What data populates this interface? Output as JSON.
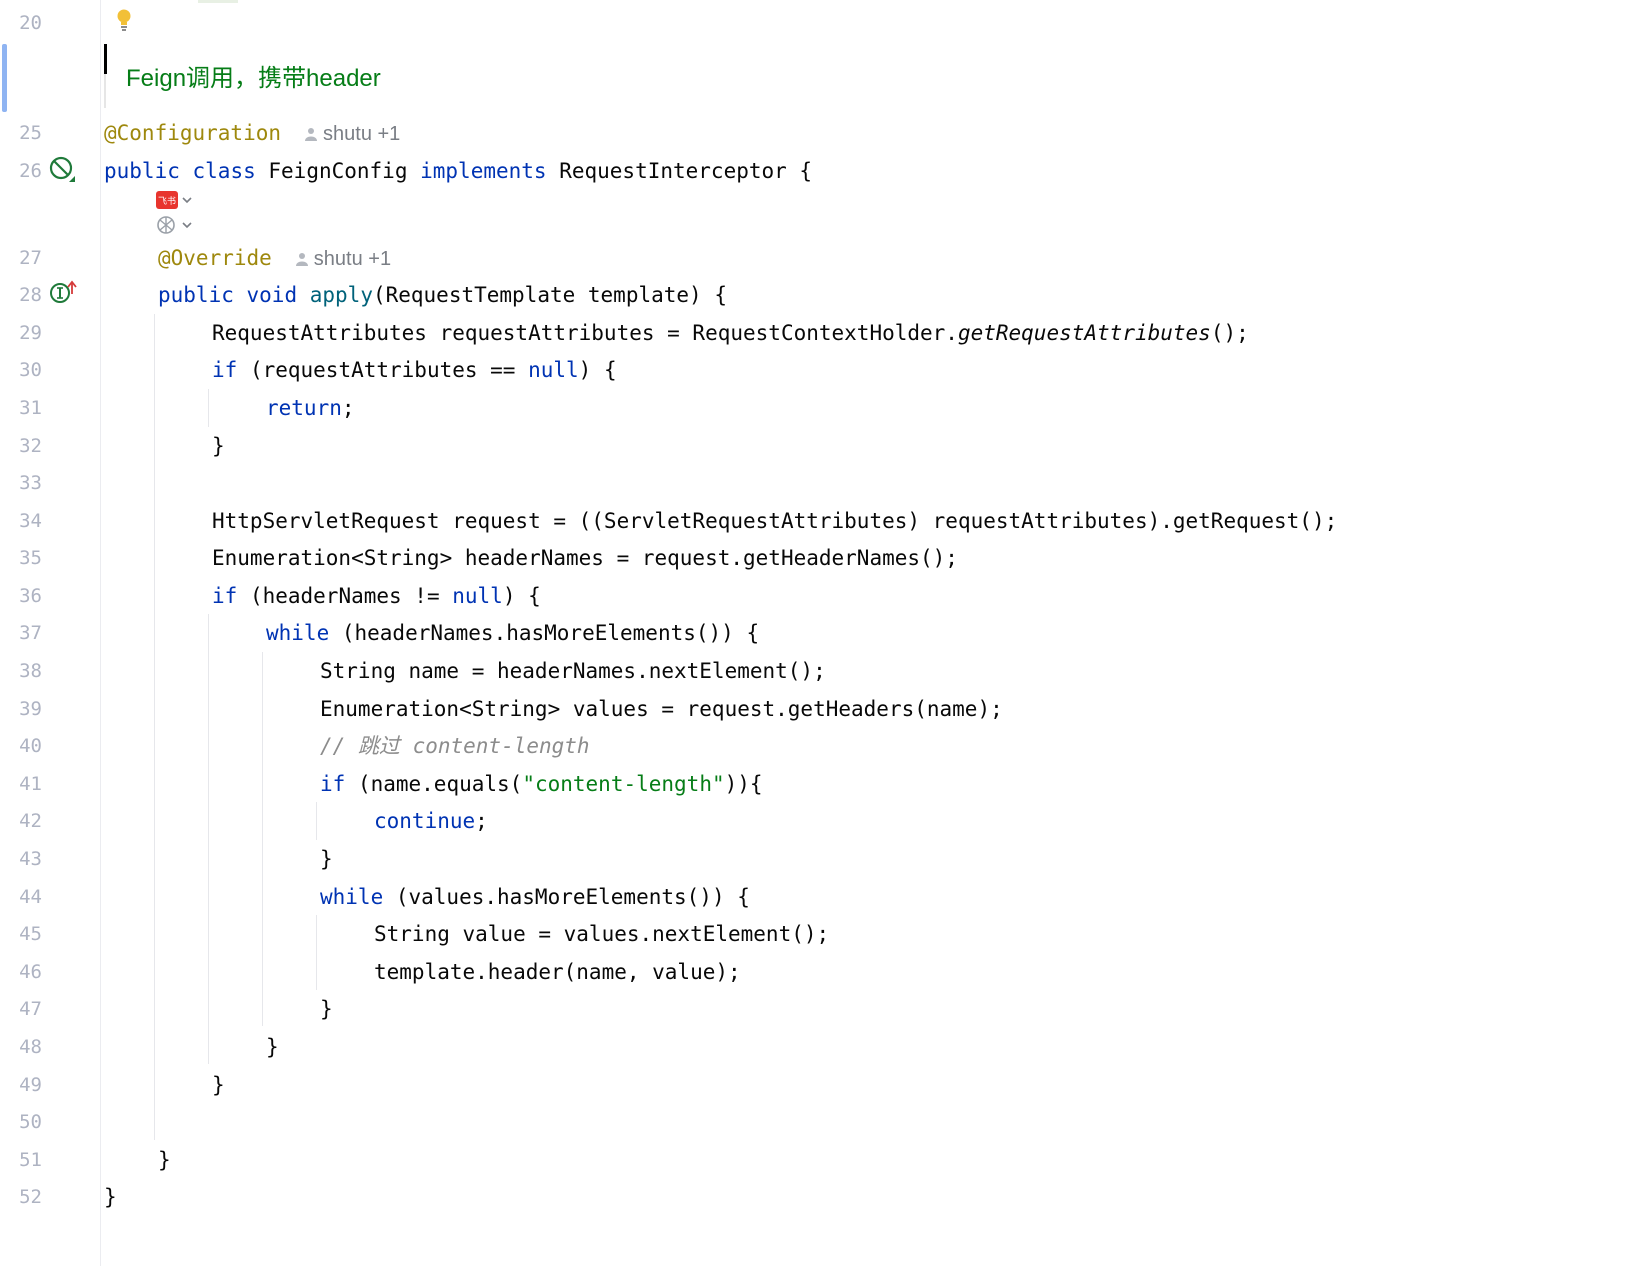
{
  "doc_comment": "Feign调用，携带header",
  "author_hint": "shutu +1",
  "line_numbers": [
    "20",
    "25",
    "26",
    "27",
    "28",
    "29",
    "30",
    "31",
    "32",
    "33",
    "34",
    "35",
    "36",
    "37",
    "38",
    "39",
    "40",
    "41",
    "42",
    "43",
    "44",
    "45",
    "46",
    "47",
    "48",
    "49",
    "50",
    "51",
    "52"
  ],
  "code": {
    "l25": "@Configuration",
    "l26_public": "public",
    "l26_class": "class",
    "l26_name": "FeignConfig",
    "l26_implements": "implements",
    "l26_iface": "RequestInterceptor {",
    "l27": "@Override",
    "l28_public": "public",
    "l28_void": "void",
    "l28_apply": "apply",
    "l28_rest": "(RequestTemplate template) {",
    "l29_a": "RequestAttributes requestAttributes = RequestContextHolder.",
    "l29_b": "getRequestAttributes",
    "l29_c": "();",
    "l30_if": "if",
    "l30_a": " (requestAttributes == ",
    "l30_null": "null",
    "l30_b": ") {",
    "l31": "return",
    "l31_semi": ";",
    "l32": "}",
    "l34": "HttpServletRequest request = ((ServletRequestAttributes) requestAttributes).getRequest();",
    "l35": "Enumeration<String> headerNames = request.getHeaderNames();",
    "l36_if": "if",
    "l36_a": " (headerNames != ",
    "l36_null": "null",
    "l36_b": ") {",
    "l37_while": "while",
    "l37_rest": " (headerNames.hasMoreElements()) {",
    "l38": "String name = headerNames.nextElement();",
    "l39": "Enumeration<String> values = request.getHeaders(name);",
    "l40": "// 跳过 content-length",
    "l41_if": "if",
    "l41_a": " (name.equals(",
    "l41_str": "\"content-length\"",
    "l41_b": ")){",
    "l42": "continue",
    "l42_semi": ";",
    "l43": "}",
    "l44_while": "while",
    "l44_rest": " (values.hasMoreElements()) {",
    "l45": "String value = values.nextElement();",
    "l46": "template.header(name, value);",
    "l47": "}",
    "l48": "}",
    "l49": "}",
    "l51": "}",
    "l52": "}"
  },
  "icons": {
    "bulb": "lightbulb-icon",
    "no_usage": "no-usage-icon",
    "implements": "implements-method-icon",
    "feishu": "feishu-plugin-icon",
    "ai": "ai-assistant-icon"
  },
  "plugin_label": "飞书"
}
